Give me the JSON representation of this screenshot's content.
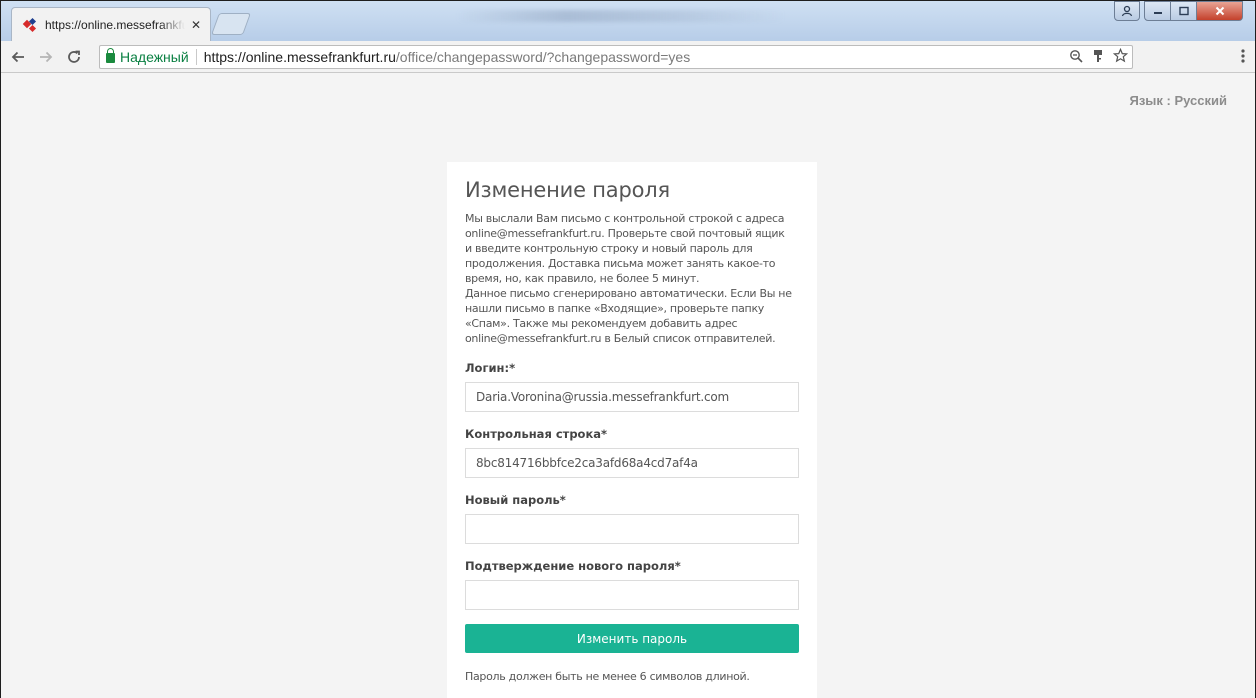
{
  "browser": {
    "tab_title": "https://online.messefrankfurt.ru/office/changepassword",
    "tab_close": "✕",
    "secure_label": "Надежный",
    "url_host": "https://online.messefrankfurt.ru",
    "url_path": "/office/changepassword/?changepassword=yes"
  },
  "page": {
    "language_label": "Язык : Русский"
  },
  "form": {
    "title": "Изменение пароля",
    "description": "Мы выслали Вам письмо с контрольной строкой с адреса\nonline@messefrankfurt.ru. Проверьте свой почтовый ящик\nи введите контрольную строку и новый пароль для\nпродолжения. Доставка письма может занять какое-то\nвремя, но, как правило, не более 5 минут.\nДанное письмо сгенерировано автоматически. Если Вы не\nнашли письмо в папке «Входящие», проверьте папку\n«Спам». Также мы рекомендуем добавить адрес\nonline@messefrankfurt.ru в Белый список отправителей.",
    "login_label": "Логин:*",
    "login_value": "Daria.Voronina@russia.messefrankfurt.com",
    "checkword_label": "Контрольная строка*",
    "checkword_value": "8bc814716bbfce2ca3afd68a4cd7af4a",
    "new_password_label": "Новый пароль*",
    "confirm_password_label": "Подтверждение нового пароля*",
    "submit_label": "Изменить пароль",
    "hint": "Пароль должен быть не менее 6 символов длиной."
  },
  "colors": {
    "accent": "#1ab394",
    "secure": "#0b8043",
    "page_bg": "#f4f4f4"
  }
}
